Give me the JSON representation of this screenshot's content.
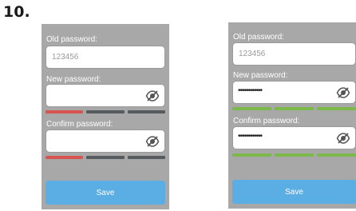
{
  "step_number": "10.",
  "colors": {
    "screen_bg": "#a8a8a8",
    "strength_weak": "#d9534f",
    "strength_empty": "#555b5f",
    "strength_strong": "#7cb84a",
    "save_button": "#5aaee4"
  },
  "screens": [
    {
      "old_password_label": "Old password:",
      "old_password_value": "123456",
      "new_password_label": "New password:",
      "new_password_value": "",
      "new_password_strength": [
        "weak",
        "empty",
        "empty"
      ],
      "confirm_password_label": "Confirm password:",
      "confirm_password_value": "",
      "confirm_password_strength": [
        "weak",
        "empty",
        "empty"
      ],
      "save_label": "Save",
      "visibility_icon": "eye-slash-icon"
    },
    {
      "old_password_label": "Old password:",
      "old_password_value": "123456",
      "new_password_label": "New password:",
      "new_password_value": "••••••••••••",
      "new_password_strength": [
        "strong",
        "strong",
        "strong"
      ],
      "confirm_password_label": "Confirm password:",
      "confirm_password_value": "••••••••••••",
      "confirm_password_strength": [
        "strong",
        "strong",
        "strong"
      ],
      "save_label": "Save",
      "visibility_icon": "eye-slash-icon"
    }
  ]
}
